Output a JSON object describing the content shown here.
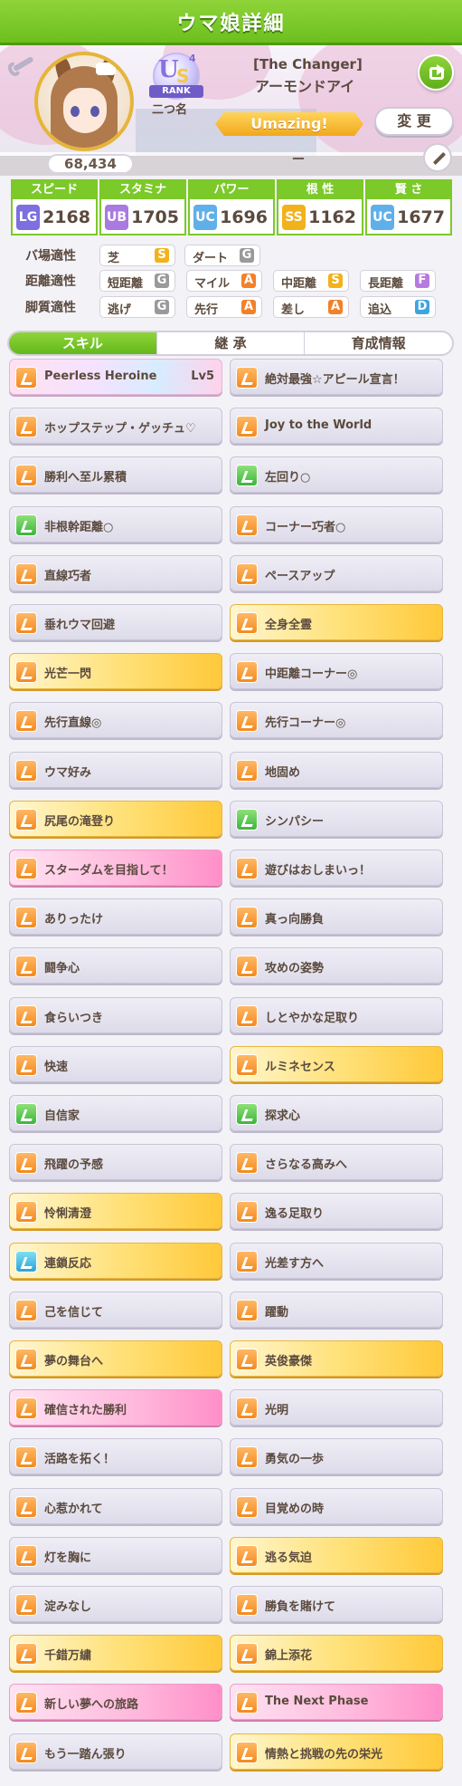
{
  "header": {
    "title": "ウマ娘詳細"
  },
  "profile": {
    "score": "68,434",
    "rank_badge": {
      "letters": "US",
      "tier": "4",
      "label": "RANK"
    },
    "nickname": "二つ名",
    "epithet": "[The Changer]",
    "name": "アーモンドアイ",
    "motivation": "Umazing!",
    "change_button": "変 更",
    "title_text": "－"
  },
  "stats": [
    {
      "label": "スピード",
      "icon": "speed-icon",
      "grade": "LG",
      "value": "2168",
      "color": "#7d6fe0"
    },
    {
      "label": "スタミナ",
      "icon": "heart-icon",
      "grade": "UB",
      "value": "1705",
      "color": "#a97ae0"
    },
    {
      "label": "パワー",
      "icon": "muscle-icon",
      "grade": "UC",
      "value": "1696",
      "color": "#5fb0e8"
    },
    {
      "label": "根 性",
      "icon": "flame-icon",
      "grade": "SS",
      "value": "1162",
      "color": "#f2b21c"
    },
    {
      "label": "賢 さ",
      "icon": "cap-icon",
      "grade": "UC",
      "value": "1677",
      "color": "#5fb0e8"
    }
  ],
  "aptitudes": {
    "track": {
      "label": "バ場適性",
      "items": [
        {
          "name": "芝",
          "grade": "S"
        },
        {
          "name": "ダート",
          "grade": "G"
        }
      ]
    },
    "distance": {
      "label": "距離適性",
      "items": [
        {
          "name": "短距離",
          "grade": "G"
        },
        {
          "name": "マイル",
          "grade": "A"
        },
        {
          "name": "中距離",
          "grade": "S"
        },
        {
          "name": "長距離",
          "grade": "F"
        }
      ]
    },
    "strategy": {
      "label": "脚質適性",
      "items": [
        {
          "name": "逃げ",
          "grade": "G"
        },
        {
          "name": "先行",
          "grade": "A"
        },
        {
          "name": "差し",
          "grade": "A"
        },
        {
          "name": "追込",
          "grade": "D"
        }
      ]
    }
  },
  "grade_colors": {
    "S": "#f2b21c",
    "A": "#f2812a",
    "G": "#9a9a9a",
    "F": "#b77be0",
    "D": "#3ea5e0"
  },
  "tabs": [
    "スキル",
    "継 承",
    "育成情報"
  ],
  "skills": [
    {
      "name": "Peerless Heroine",
      "level": "Lv5",
      "style": "rainbow",
      "icon": "orange"
    },
    {
      "name": "絶対最強☆アピール宣言！",
      "style": "plain",
      "icon": "orange"
    },
    {
      "name": "ホップステップ・ゲッチュ♡",
      "style": "plain",
      "icon": "orange"
    },
    {
      "name": "Joy to the World",
      "style": "plain",
      "icon": "orange"
    },
    {
      "name": "勝利へ至ル累積",
      "style": "plain",
      "icon": "orange"
    },
    {
      "name": "左回り○",
      "style": "plain",
      "icon": "green"
    },
    {
      "name": "非根幹距離○",
      "style": "plain",
      "icon": "green"
    },
    {
      "name": "コーナー巧者○",
      "style": "plain",
      "icon": "orange"
    },
    {
      "name": "直線巧者",
      "style": "plain",
      "icon": "orange"
    },
    {
      "name": "ペースアップ",
      "style": "plain",
      "icon": "orange"
    },
    {
      "name": "垂れウマ回避",
      "style": "plain",
      "icon": "orange"
    },
    {
      "name": "全身全霊",
      "style": "gold",
      "icon": "orange"
    },
    {
      "name": "光芒一閃",
      "style": "gold",
      "icon": "orange"
    },
    {
      "name": "中距離コーナー◎",
      "style": "plain",
      "icon": "orange"
    },
    {
      "name": "先行直線◎",
      "style": "plain",
      "icon": "orange"
    },
    {
      "name": "先行コーナー◎",
      "style": "plain",
      "icon": "orange"
    },
    {
      "name": "ウマ好み",
      "style": "plain",
      "icon": "orange"
    },
    {
      "name": "地固め",
      "style": "plain",
      "icon": "orange"
    },
    {
      "name": "尻尾の滝登り",
      "style": "gold",
      "icon": "orange"
    },
    {
      "name": "シンパシー",
      "style": "plain",
      "icon": "green"
    },
    {
      "name": "スターダムを目指して！",
      "style": "pink",
      "icon": "orange"
    },
    {
      "name": "遊びはおしまいっ！",
      "style": "plain",
      "icon": "orange"
    },
    {
      "name": "ありったけ",
      "style": "plain",
      "icon": "orange"
    },
    {
      "name": "真っ向勝負",
      "style": "plain",
      "icon": "orange"
    },
    {
      "name": "闘争心",
      "style": "plain",
      "icon": "orange"
    },
    {
      "name": "攻めの姿勢",
      "style": "plain",
      "icon": "orange"
    },
    {
      "name": "食らいつき",
      "style": "plain",
      "icon": "orange"
    },
    {
      "name": "しとやかな足取り",
      "style": "plain",
      "icon": "orange"
    },
    {
      "name": "快速",
      "style": "plain",
      "icon": "orange"
    },
    {
      "name": "ルミネセンス",
      "style": "gold",
      "icon": "orange"
    },
    {
      "name": "自信家",
      "style": "plain",
      "icon": "green"
    },
    {
      "name": "探求心",
      "style": "plain",
      "icon": "green"
    },
    {
      "name": "飛躍の予感",
      "style": "plain",
      "icon": "orange"
    },
    {
      "name": "さらなる高みへ",
      "style": "plain",
      "icon": "orange"
    },
    {
      "name": "怜悧清澄",
      "style": "gold",
      "icon": "orange"
    },
    {
      "name": "逸る足取り",
      "style": "plain",
      "icon": "orange"
    },
    {
      "name": "連鎖反応",
      "style": "gold",
      "icon": "teal"
    },
    {
      "name": "光差す方へ",
      "style": "plain",
      "icon": "orange"
    },
    {
      "name": "己を信じて",
      "style": "plain",
      "icon": "orange"
    },
    {
      "name": "躍動",
      "style": "plain",
      "icon": "orange"
    },
    {
      "name": "夢の舞台へ",
      "style": "gold",
      "icon": "orange"
    },
    {
      "name": "英俊豪傑",
      "style": "gold",
      "icon": "orange"
    },
    {
      "name": "確信された勝利",
      "style": "pink",
      "icon": "orange"
    },
    {
      "name": "光明",
      "style": "plain",
      "icon": "orange"
    },
    {
      "name": "活路を拓く！",
      "style": "plain",
      "icon": "orange"
    },
    {
      "name": "勇気の一歩",
      "style": "plain",
      "icon": "orange"
    },
    {
      "name": "心惹かれて",
      "style": "plain",
      "icon": "orange"
    },
    {
      "name": "目覚めの時",
      "style": "plain",
      "icon": "orange"
    },
    {
      "name": "灯を胸に",
      "style": "plain",
      "icon": "orange"
    },
    {
      "name": "逃る気迫",
      "style": "gold",
      "icon": "orange"
    },
    {
      "name": "淀みなし",
      "style": "plain",
      "icon": "orange"
    },
    {
      "name": "勝負を賭けて",
      "style": "plain",
      "icon": "orange"
    },
    {
      "name": "千錯万繍",
      "style": "gold",
      "icon": "orange"
    },
    {
      "name": "錦上添花",
      "style": "gold",
      "icon": "orange"
    },
    {
      "name": "新しい夢への旅路",
      "style": "pink",
      "icon": "orange"
    },
    {
      "name": "The Next Phase",
      "style": "pink",
      "icon": "orange"
    },
    {
      "name": "もう一踏ん張り",
      "style": "plain",
      "icon": "orange"
    },
    {
      "name": "情熱と挑戦の先の栄光",
      "style": "gold",
      "icon": "orange"
    }
  ]
}
